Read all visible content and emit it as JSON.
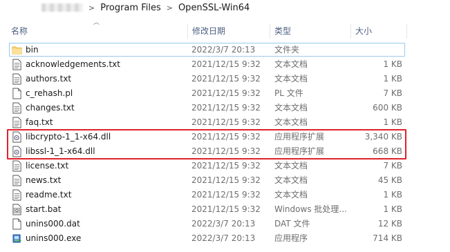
{
  "breadcrumb": {
    "separator": ">",
    "items": [
      "Program Files",
      "OpenSSL-Win64"
    ]
  },
  "columns": {
    "name": "名称",
    "date": "修改日期",
    "type": "类型",
    "size": "大小"
  },
  "files": [
    {
      "name": "bin",
      "date": "2022/3/7 20:13",
      "type": "文件夹",
      "size": "",
      "icon": "folder-icon"
    },
    {
      "name": "acknowledgements.txt",
      "date": "2021/12/15 9:32",
      "type": "文本文档",
      "size": "1 KB",
      "icon": "text-document-icon"
    },
    {
      "name": "authors.txt",
      "date": "2021/12/15 9:32",
      "type": "文本文档",
      "size": "1 KB",
      "icon": "text-document-icon"
    },
    {
      "name": "c_rehash.pl",
      "date": "2021/12/15 9:32",
      "type": "PL 文件",
      "size": "7 KB",
      "icon": "blank-file-icon"
    },
    {
      "name": "changes.txt",
      "date": "2021/12/15 9:32",
      "type": "文本文档",
      "size": "600 KB",
      "icon": "text-document-icon"
    },
    {
      "name": "faq.txt",
      "date": "2021/12/15 9:32",
      "type": "文本文档",
      "size": "1 KB",
      "icon": "text-document-icon"
    },
    {
      "name": "libcrypto-1_1-x64.dll",
      "date": "2021/12/15 9:32",
      "type": "应用程序扩展",
      "size": "3,340 KB",
      "icon": "dll-gear-icon"
    },
    {
      "name": "libssl-1_1-x64.dll",
      "date": "2021/12/15 9:32",
      "type": "应用程序扩展",
      "size": "668 KB",
      "icon": "dll-gear-icon"
    },
    {
      "name": "license.txt",
      "date": "2021/12/15 9:32",
      "type": "文本文档",
      "size": "7 KB",
      "icon": "text-document-icon"
    },
    {
      "name": "news.txt",
      "date": "2021/12/15 9:32",
      "type": "文本文档",
      "size": "45 KB",
      "icon": "text-document-icon"
    },
    {
      "name": "readme.txt",
      "date": "2021/12/15 9:32",
      "type": "文本文档",
      "size": "1 KB",
      "icon": "text-document-icon"
    },
    {
      "name": "start.bat",
      "date": "2021/12/15 9:32",
      "type": "Windows 批处理...",
      "size": "1 KB",
      "icon": "batch-file-icon"
    },
    {
      "name": "unins000.dat",
      "date": "2022/3/7 20:13",
      "type": "DAT 文件",
      "size": "12 KB",
      "icon": "blank-file-icon"
    },
    {
      "name": "unins000.exe",
      "date": "2022/3/7 20:13",
      "type": "应用程序",
      "size": "714 KB",
      "icon": "installer-exe-icon"
    }
  ],
  "colors": {
    "highlight_box": "#e0202a",
    "folder_selection_border": "#99c9ef",
    "header_text": "#4d6082",
    "folder_yellow": "#f8d775"
  }
}
